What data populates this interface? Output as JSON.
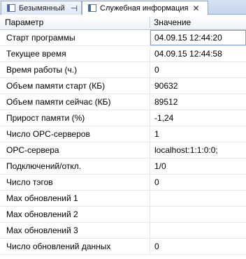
{
  "tabs": [
    {
      "label": "Безымянный",
      "active": false
    },
    {
      "label": "Служебная информация",
      "active": true
    }
  ],
  "table": {
    "headers": {
      "param": "Параметр",
      "value": "Значение"
    },
    "rows": [
      {
        "name": "Старт программы",
        "value": "04.09.15 12:44:20"
      },
      {
        "name": "Текущее время",
        "value": "04.09.15 12:44:58"
      },
      {
        "name": "Время работы (ч.)",
        "value": "0"
      },
      {
        "name": "Объем памяти старт (КБ)",
        "value": "90632"
      },
      {
        "name": "Объем памяти сейчас (КБ)",
        "value": "89512"
      },
      {
        "name": "Прирост памяти  (%)",
        "value": "-1,24"
      },
      {
        "name": "Число OPC-серверов",
        "value": "1"
      },
      {
        "name": "OPC-сервера",
        "value": "localhost:1:1:0:0;"
      },
      {
        "name": "Подключений/откл.",
        "value": "1/0"
      },
      {
        "name": "Число тэгов",
        "value": "0"
      },
      {
        "name": "Max обновлений 1",
        "value": ""
      },
      {
        "name": "Max обновлений 2",
        "value": ""
      },
      {
        "name": "Max обновлений 3",
        "value": ""
      },
      {
        "name": "Число обновлений данных",
        "value": "0"
      }
    ]
  },
  "colors": {
    "tabbar": "#c9dbf1",
    "grid_line": "#e4e7ec",
    "selection": "#7aa2d8"
  }
}
